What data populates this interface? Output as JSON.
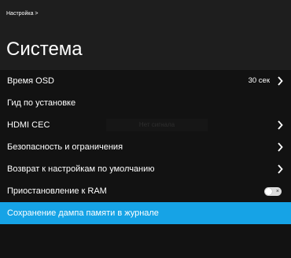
{
  "breadcrumb": "Настройка >",
  "title": "Система",
  "no_signal": "Нет сигнала",
  "colors": {
    "accent": "#16a3e6",
    "background": "#121212",
    "header": "#1e1e1e"
  },
  "items": [
    {
      "label": "Время OSD",
      "value": "30 сек",
      "chevron": true
    },
    {
      "label": "Гид по установке"
    },
    {
      "label": "HDMI CEC",
      "chevron": true
    },
    {
      "label": "Безопасность и ограничения",
      "chevron": true
    },
    {
      "label": "Возврат к настройкам по умолчанию",
      "chevron": true
    },
    {
      "label": "Приостановление к RAM",
      "toggle": "off",
      "toggle_glyph": "×"
    },
    {
      "label": "Сохранение дампа памяти в журнале",
      "selected": true
    }
  ]
}
